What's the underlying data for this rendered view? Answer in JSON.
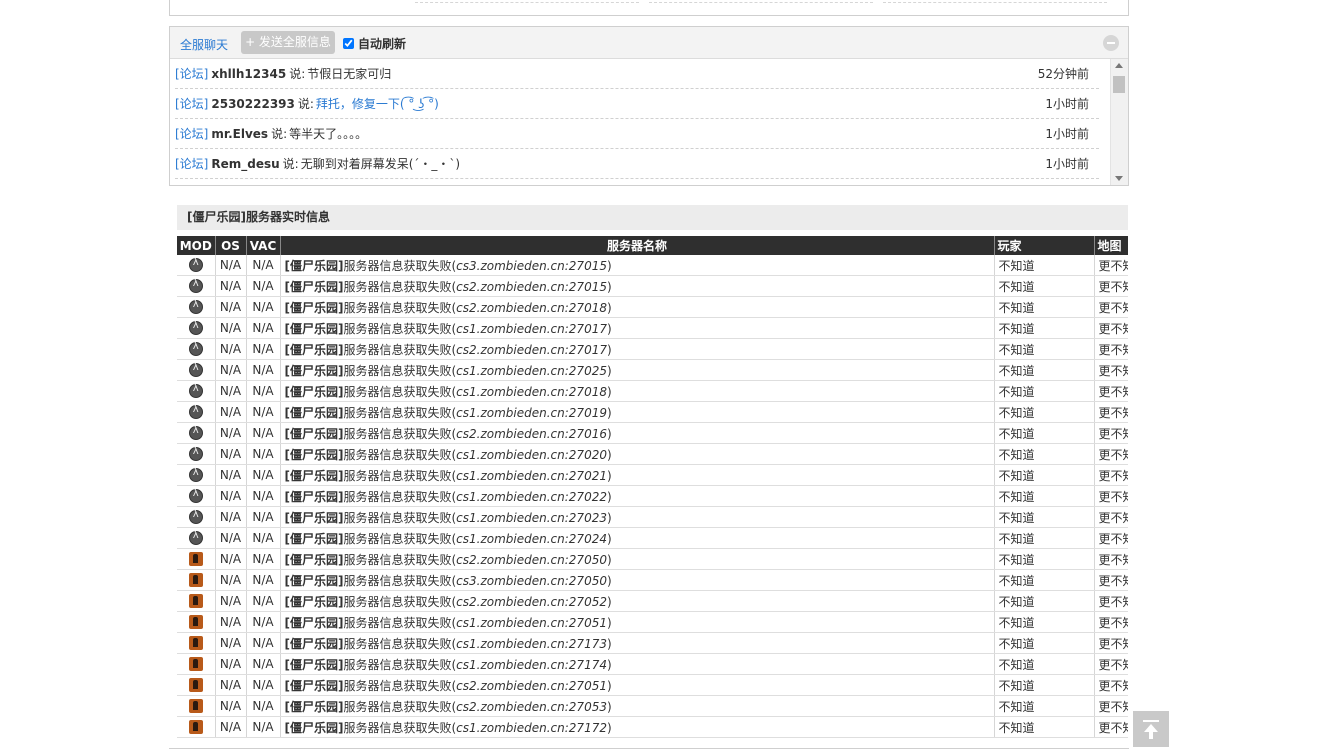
{
  "chat": {
    "title": "全服聊天",
    "send_label": "+ 发送全服信息",
    "auto_refresh_label": "自动刷新",
    "auto_refresh_checked": true,
    "messages": [
      {
        "source": "[论坛]",
        "user": "xhllh12345",
        "said": "说:",
        "text": "节假日无家可归",
        "text_link": false,
        "time": "52分钟前"
      },
      {
        "source": "[论坛]",
        "user": "2530222393",
        "said": "说:",
        "text": "拜托，修复一下( ͡° ͜ʖ ͡°)",
        "text_link": true,
        "time": "1小时前"
      },
      {
        "source": "[论坛]",
        "user": "mr.Elves",
        "said": "说:",
        "text": "等半天了。。。。",
        "text_link": false,
        "time": "1小时前"
      },
      {
        "source": "[论坛]",
        "user": "Rem_desu",
        "said": "说:",
        "text": "无聊到对着屏幕发呆(´・_・`)",
        "text_link": false,
        "time": "1小时前"
      }
    ]
  },
  "server": {
    "title": "[僵尸乐园]服务器实时信息",
    "columns": {
      "mod": "MOD",
      "os": "OS",
      "vac": "VAC",
      "name": "服务器名称",
      "players": "玩家",
      "map": "地图"
    },
    "rows": [
      {
        "mod": "hl-icon",
        "os": "N/A",
        "vac": "N/A",
        "tag": "[僵尸乐园]",
        "status": "服务器信息获取失败(",
        "address": "cs3.zombieden.cn:27015",
        "close": ")",
        "players": "不知道",
        "map": "更不知道"
      },
      {
        "mod": "hl-icon",
        "os": "N/A",
        "vac": "N/A",
        "tag": "[僵尸乐园]",
        "status": "服务器信息获取失败(",
        "address": "cs2.zombieden.cn:27015",
        "close": ")",
        "players": "不知道",
        "map": "更不知道"
      },
      {
        "mod": "hl-icon",
        "os": "N/A",
        "vac": "N/A",
        "tag": "[僵尸乐园]",
        "status": "服务器信息获取失败(",
        "address": "cs2.zombieden.cn:27018",
        "close": ")",
        "players": "不知道",
        "map": "更不知道"
      },
      {
        "mod": "hl-icon",
        "os": "N/A",
        "vac": "N/A",
        "tag": "[僵尸乐园]",
        "status": "服务器信息获取失败(",
        "address": "cs1.zombieden.cn:27017",
        "close": ")",
        "players": "不知道",
        "map": "更不知道"
      },
      {
        "mod": "hl-icon",
        "os": "N/A",
        "vac": "N/A",
        "tag": "[僵尸乐园]",
        "status": "服务器信息获取失败(",
        "address": "cs2.zombieden.cn:27017",
        "close": ")",
        "players": "不知道",
        "map": "更不知道"
      },
      {
        "mod": "hl-icon",
        "os": "N/A",
        "vac": "N/A",
        "tag": "[僵尸乐园]",
        "status": "服务器信息获取失败(",
        "address": "cs1.zombieden.cn:27025",
        "close": ")",
        "players": "不知道",
        "map": "更不知道"
      },
      {
        "mod": "hl-icon",
        "os": "N/A",
        "vac": "N/A",
        "tag": "[僵尸乐园]",
        "status": "服务器信息获取失败(",
        "address": "cs1.zombieden.cn:27018",
        "close": ")",
        "players": "不知道",
        "map": "更不知道"
      },
      {
        "mod": "hl-icon",
        "os": "N/A",
        "vac": "N/A",
        "tag": "[僵尸乐园]",
        "status": "服务器信息获取失败(",
        "address": "cs1.zombieden.cn:27019",
        "close": ")",
        "players": "不知道",
        "map": "更不知道"
      },
      {
        "mod": "hl-icon",
        "os": "N/A",
        "vac": "N/A",
        "tag": "[僵尸乐园]",
        "status": "服务器信息获取失败(",
        "address": "cs2.zombieden.cn:27016",
        "close": ")",
        "players": "不知道",
        "map": "更不知道"
      },
      {
        "mod": "hl-icon",
        "os": "N/A",
        "vac": "N/A",
        "tag": "[僵尸乐园]",
        "status": "服务器信息获取失败(",
        "address": "cs1.zombieden.cn:27020",
        "close": ")",
        "players": "不知道",
        "map": "更不知道"
      },
      {
        "mod": "hl-icon",
        "os": "N/A",
        "vac": "N/A",
        "tag": "[僵尸乐园]",
        "status": "服务器信息获取失败(",
        "address": "cs1.zombieden.cn:27021",
        "close": ")",
        "players": "不知道",
        "map": "更不知道"
      },
      {
        "mod": "hl-icon",
        "os": "N/A",
        "vac": "N/A",
        "tag": "[僵尸乐园]",
        "status": "服务器信息获取失败(",
        "address": "cs1.zombieden.cn:27022",
        "close": ")",
        "players": "不知道",
        "map": "更不知道"
      },
      {
        "mod": "hl-icon",
        "os": "N/A",
        "vac": "N/A",
        "tag": "[僵尸乐园]",
        "status": "服务器信息获取失败(",
        "address": "cs1.zombieden.cn:27023",
        "close": ")",
        "players": "不知道",
        "map": "更不知道"
      },
      {
        "mod": "hl-icon",
        "os": "N/A",
        "vac": "N/A",
        "tag": "[僵尸乐园]",
        "status": "服务器信息获取失败(",
        "address": "cs1.zombieden.cn:27024",
        "close": ")",
        "players": "不知道",
        "map": "更不知道"
      },
      {
        "mod": "cs-icon",
        "os": "N/A",
        "vac": "N/A",
        "tag": "[僵尸乐园]",
        "status": "服务器信息获取失败(",
        "address": "cs2.zombieden.cn:27050",
        "close": ")",
        "players": "不知道",
        "map": "更不知道"
      },
      {
        "mod": "cs-icon",
        "os": "N/A",
        "vac": "N/A",
        "tag": "[僵尸乐园]",
        "status": "服务器信息获取失败(",
        "address": "cs3.zombieden.cn:27050",
        "close": ")",
        "players": "不知道",
        "map": "更不知道"
      },
      {
        "mod": "cs-icon",
        "os": "N/A",
        "vac": "N/A",
        "tag": "[僵尸乐园]",
        "status": "服务器信息获取失败(",
        "address": "cs2.zombieden.cn:27052",
        "close": ")",
        "players": "不知道",
        "map": "更不知道"
      },
      {
        "mod": "cs-icon",
        "os": "N/A",
        "vac": "N/A",
        "tag": "[僵尸乐园]",
        "status": "服务器信息获取失败(",
        "address": "cs1.zombieden.cn:27051",
        "close": ")",
        "players": "不知道",
        "map": "更不知道"
      },
      {
        "mod": "cs-icon",
        "os": "N/A",
        "vac": "N/A",
        "tag": "[僵尸乐园]",
        "status": "服务器信息获取失败(",
        "address": "cs1.zombieden.cn:27173",
        "close": ")",
        "players": "不知道",
        "map": "更不知道"
      },
      {
        "mod": "cs-icon",
        "os": "N/A",
        "vac": "N/A",
        "tag": "[僵尸乐园]",
        "status": "服务器信息获取失败(",
        "address": "cs1.zombieden.cn:27174",
        "close": ")",
        "players": "不知道",
        "map": "更不知道"
      },
      {
        "mod": "cs-icon",
        "os": "N/A",
        "vac": "N/A",
        "tag": "[僵尸乐园]",
        "status": "服务器信息获取失败(",
        "address": "cs2.zombieden.cn:27051",
        "close": ")",
        "players": "不知道",
        "map": "更不知道"
      },
      {
        "mod": "cs-icon",
        "os": "N/A",
        "vac": "N/A",
        "tag": "[僵尸乐园]",
        "status": "服务器信息获取失败(",
        "address": "cs2.zombieden.cn:27053",
        "close": ")",
        "players": "不知道",
        "map": "更不知道"
      },
      {
        "mod": "cs-icon",
        "os": "N/A",
        "vac": "N/A",
        "tag": "[僵尸乐园]",
        "status": "服务器信息获取失败(",
        "address": "cs1.zombieden.cn:27172",
        "close": ")",
        "players": "不知道",
        "map": "更不知道"
      }
    ]
  },
  "colors": {
    "link": "#2a7ad2",
    "table_header": "#2f2f2f",
    "panel_bg": "#f3f3f3"
  }
}
